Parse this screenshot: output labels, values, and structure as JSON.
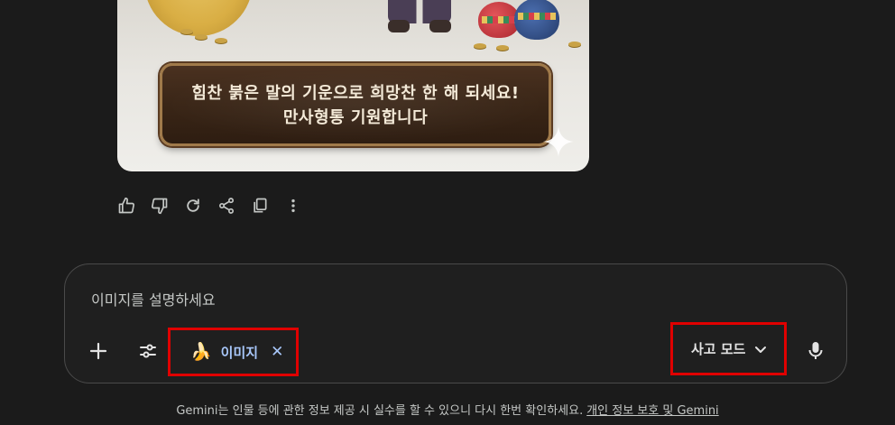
{
  "image_card": {
    "line1": "힘찬 붉은 말의 기운으로 희망찬 한 해 되세요!",
    "line2": "만사형통 기원합니다"
  },
  "actions": [
    {
      "icon": "thumbs-up-icon"
    },
    {
      "icon": "thumbs-down-icon"
    },
    {
      "icon": "redo-icon"
    },
    {
      "icon": "share-icon"
    },
    {
      "icon": "copy-icon"
    },
    {
      "icon": "more-vert-icon"
    }
  ],
  "input": {
    "placeholder": "이미지를 설명하세요"
  },
  "toolbar": {
    "add_icon": "plus-icon",
    "tools_icon": "tune-icon",
    "chip": {
      "emoji": "🍌",
      "label": "이미지",
      "close": "✕"
    },
    "mode_label": "사고 모드",
    "mic_icon": "mic-icon"
  },
  "footer": {
    "disclaimer": "Gemini는 인물 등에 관한 정보 제공 시 실수를 할 수 있으니 다시 한번 확인하세요.",
    "link": "개인 정보 보호 및 Gemini"
  },
  "colors": {
    "background": "#1b1b1b",
    "accent": "#a8c7fa",
    "highlight_box": "#e00000"
  }
}
